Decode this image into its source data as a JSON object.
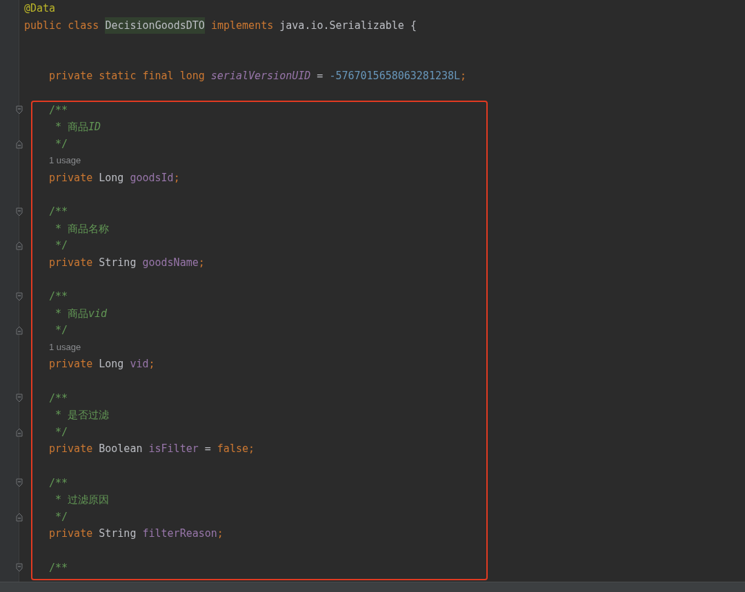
{
  "editor": {
    "header_lines": [
      {
        "kind": "code",
        "tokens": [
          {
            "kind": "annotation",
            "text": "@Data"
          }
        ]
      },
      {
        "kind": "code",
        "tokens": [
          {
            "kind": "keyword",
            "text": "public class "
          },
          {
            "kind": "plain",
            "text": "DecisionGoodsDTO",
            "highlighted": true
          },
          {
            "kind": "keyword",
            "text": " implements "
          },
          {
            "kind": "plain",
            "text": "java.io.Serializable {"
          }
        ]
      }
    ],
    "body_lines": [
      {
        "kind": "blank"
      },
      {
        "kind": "blank"
      },
      {
        "kind": "code",
        "tokens": [
          {
            "kind": "keyword",
            "text": "private static final long "
          },
          {
            "kind": "static_field",
            "text": "serialVersionUID"
          },
          {
            "kind": "plain",
            "text": " = "
          },
          {
            "kind": "number",
            "text": "-5767015658063281238L"
          },
          {
            "kind": "keyword",
            "text": ";"
          }
        ]
      },
      {
        "kind": "blank"
      }
    ],
    "highlighted_block": [
      {
        "kind": "doc_open",
        "tokens": [
          {
            "kind": "doc",
            "text": "/**"
          }
        ]
      },
      {
        "kind": "doc_line",
        "tokens": [
          {
            "kind": "doc",
            "text": "* 商品"
          },
          {
            "kind": "doc_italic",
            "text": "ID"
          }
        ]
      },
      {
        "kind": "doc_close",
        "tokens": [
          {
            "kind": "doc",
            "text": "*/"
          }
        ]
      },
      {
        "kind": "usage",
        "text": "1 usage"
      },
      {
        "kind": "code",
        "tokens": [
          {
            "kind": "keyword",
            "text": "private "
          },
          {
            "kind": "plain",
            "text": "Long "
          },
          {
            "kind": "field",
            "text": "goodsId"
          },
          {
            "kind": "keyword",
            "text": ";"
          }
        ]
      },
      {
        "kind": "blank"
      },
      {
        "kind": "doc_open",
        "tokens": [
          {
            "kind": "doc",
            "text": "/**"
          }
        ]
      },
      {
        "kind": "doc_line",
        "tokens": [
          {
            "kind": "doc",
            "text": "* 商品名称"
          }
        ]
      },
      {
        "kind": "doc_close",
        "tokens": [
          {
            "kind": "doc",
            "text": "*/"
          }
        ]
      },
      {
        "kind": "code",
        "tokens": [
          {
            "kind": "keyword",
            "text": "private "
          },
          {
            "kind": "plain",
            "text": "String "
          },
          {
            "kind": "field",
            "text": "goodsName"
          },
          {
            "kind": "keyword",
            "text": ";"
          }
        ]
      },
      {
        "kind": "blank"
      },
      {
        "kind": "doc_open",
        "tokens": [
          {
            "kind": "doc",
            "text": "/**"
          }
        ]
      },
      {
        "kind": "doc_line",
        "tokens": [
          {
            "kind": "doc",
            "text": "* 商品"
          },
          {
            "kind": "doc_italic",
            "text": "vid"
          }
        ]
      },
      {
        "kind": "doc_close",
        "tokens": [
          {
            "kind": "doc",
            "text": "*/"
          }
        ]
      },
      {
        "kind": "usage",
        "text": "1 usage"
      },
      {
        "kind": "code",
        "tokens": [
          {
            "kind": "keyword",
            "text": "private "
          },
          {
            "kind": "plain",
            "text": "Long "
          },
          {
            "kind": "field",
            "text": "vid"
          },
          {
            "kind": "keyword",
            "text": ";"
          }
        ]
      },
      {
        "kind": "blank"
      },
      {
        "kind": "doc_open",
        "tokens": [
          {
            "kind": "doc",
            "text": "/**"
          }
        ]
      },
      {
        "kind": "doc_line",
        "tokens": [
          {
            "kind": "doc",
            "text": "* 是否过滤"
          }
        ]
      },
      {
        "kind": "doc_close",
        "tokens": [
          {
            "kind": "doc",
            "text": "*/"
          }
        ]
      },
      {
        "kind": "code",
        "tokens": [
          {
            "kind": "keyword",
            "text": "private "
          },
          {
            "kind": "plain",
            "text": "Boolean "
          },
          {
            "kind": "field",
            "text": "isFilter"
          },
          {
            "kind": "plain",
            "text": " = "
          },
          {
            "kind": "keyword",
            "text": "false;"
          }
        ]
      },
      {
        "kind": "blank"
      },
      {
        "kind": "doc_open",
        "tokens": [
          {
            "kind": "doc",
            "text": "/**"
          }
        ]
      },
      {
        "kind": "doc_line",
        "tokens": [
          {
            "kind": "doc",
            "text": "* 过滤原因"
          }
        ]
      },
      {
        "kind": "doc_close",
        "tokens": [
          {
            "kind": "doc",
            "text": "*/"
          }
        ]
      },
      {
        "kind": "code",
        "tokens": [
          {
            "kind": "keyword",
            "text": "private "
          },
          {
            "kind": "plain",
            "text": "String "
          },
          {
            "kind": "field",
            "text": "filterReason"
          },
          {
            "kind": "keyword",
            "text": ";"
          }
        ]
      },
      {
        "kind": "blank"
      },
      {
        "kind": "doc_open",
        "tokens": [
          {
            "kind": "doc",
            "text": "/**"
          }
        ]
      }
    ]
  }
}
